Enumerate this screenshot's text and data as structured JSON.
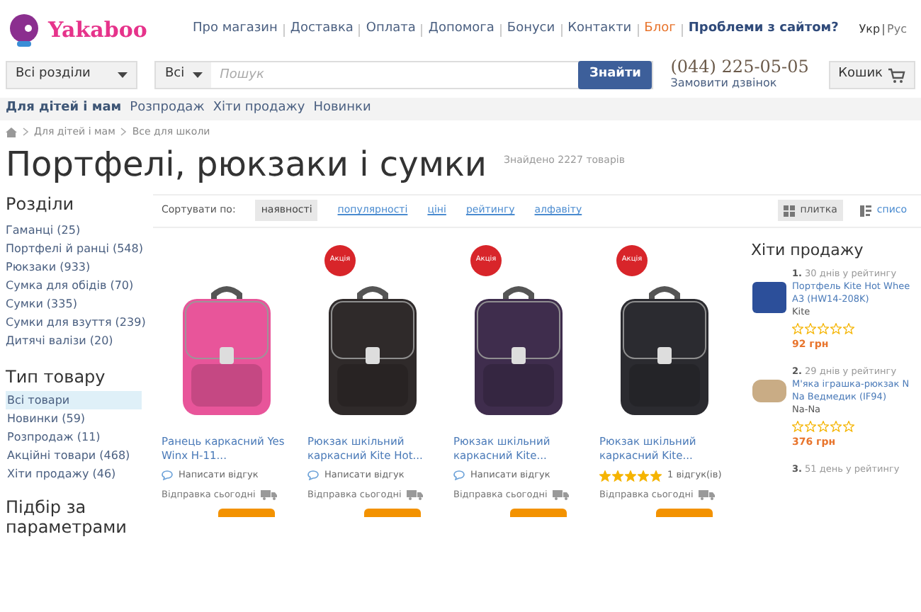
{
  "header": {
    "logo": "Yakaboo",
    "nav": [
      {
        "label": "Про магазин",
        "kind": "link"
      },
      {
        "label": "Доставка",
        "kind": "link"
      },
      {
        "label": "Оплата",
        "kind": "link"
      },
      {
        "label": "Допомога",
        "kind": "link"
      },
      {
        "label": "Бонуси",
        "kind": "link"
      },
      {
        "label": "Контакти",
        "kind": "link"
      },
      {
        "label": "Блог",
        "kind": "accent"
      },
      {
        "label": "Проблеми з сайтом?",
        "kind": "strong"
      }
    ],
    "languages": [
      {
        "label": "Укр",
        "selected": true
      },
      {
        "label": "Рус",
        "selected": false
      }
    ]
  },
  "search": {
    "category": "Всі розділи",
    "scope": "Всі",
    "placeholder": "Пошук",
    "button": "Знайти",
    "phone": "(044) 225-05-05",
    "callback": "Замовити дзвінок",
    "cart": "Кошик"
  },
  "category_nav": [
    {
      "label": "Для дітей і мам",
      "selected": true
    },
    {
      "label": "Розпродаж",
      "selected": false
    },
    {
      "label": "Хіти продажу",
      "selected": false
    },
    {
      "label": "Новинки",
      "selected": false
    }
  ],
  "breadcrumbs": [
    "Для дітей і мам",
    "Все для школи"
  ],
  "title": "Портфелі, рюкзаки і сумки",
  "found": "Знайдено 2227 товарів",
  "sidebar": {
    "sections_title": "Розділи",
    "sections": [
      "Гаманці (25)",
      "Портфелі й ранці (548)",
      "Рюкзаки (933)",
      "Сумка для обідів (70)",
      "Сумки (335)",
      "Сумки для взуття (239)",
      "Дитячі валізи (20)"
    ],
    "type_title": "Тип товару",
    "types": [
      {
        "label": "Всі товари",
        "selected": true
      },
      {
        "label": "Новинки (59)",
        "selected": false
      },
      {
        "label": "Розпродаж (11)",
        "selected": false
      },
      {
        "label": "Акційні товари (468)",
        "selected": false
      },
      {
        "label": "Хіти продажу (46)",
        "selected": false
      }
    ],
    "filter_title": "Підбір за параметрами"
  },
  "sort": {
    "label": "Сортувати по:",
    "options": [
      {
        "label": "наявності",
        "selected": true
      },
      {
        "label": "популярності",
        "selected": false
      },
      {
        "label": "ціні",
        "selected": false
      },
      {
        "label": "рейтингу",
        "selected": false
      },
      {
        "label": "алфавіту",
        "selected": false
      }
    ],
    "views": [
      {
        "label": "плитка",
        "selected": true,
        "kind": "grid"
      },
      {
        "label": "списо",
        "selected": false,
        "kind": "list"
      }
    ]
  },
  "products": [
    {
      "name": "Ранець каркасний Yes Winx H-11...",
      "sale": false,
      "review": "Написати відгук",
      "shipping": "Відправка сьогодні"
    },
    {
      "name": "Рюкзак шкільний каркасний Kite Hot...",
      "sale": true,
      "badge": "Акція",
      "review": "Написати відгук",
      "shipping": "Відправка сьогодні"
    },
    {
      "name": "Рюкзак шкільний каркасний Kite...",
      "sale": true,
      "badge": "Акція",
      "review": "Написати відгук",
      "shipping": "Відправка сьогодні"
    },
    {
      "name": "Рюкзак шкільний каркасний Kite...",
      "sale": true,
      "badge": "Акція",
      "stars": 5,
      "review": "1 відгук(ів)",
      "shipping": "Відправка сьогодні"
    }
  ],
  "bestsellers": {
    "title": "Хіти продажу",
    "items": [
      {
        "rank": "1.",
        "days": "30 днів у рейтингу",
        "name": "Портфель Kite Hot Whee",
        "name2": "А3 (HW14-208K)",
        "brand": "Kite",
        "stars": 0,
        "price": "92 грн"
      },
      {
        "rank": "2.",
        "days": "29 днів у рейтингу",
        "name": "М'яка іграшка-рюкзак N",
        "name2": "Na Ведмедик (IF94)",
        "brand": "Na-Na",
        "stars": 0,
        "price": "376 грн"
      },
      {
        "rank": "3.",
        "days": "51 день у рейтингу"
      }
    ]
  }
}
